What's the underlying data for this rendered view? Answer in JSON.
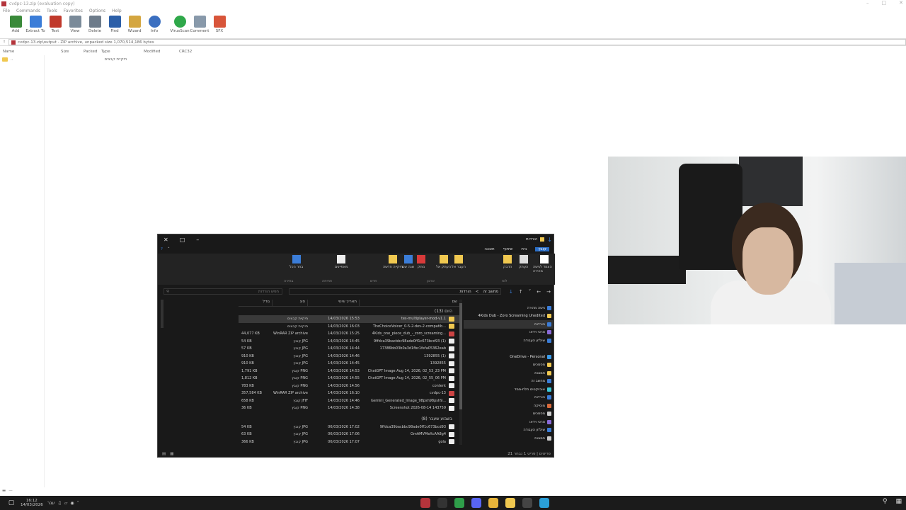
{
  "winrar": {
    "title": "cvdpc-13.zip (evaluation copy)",
    "menu": [
      "File",
      "Commands",
      "Tools",
      "Favorites",
      "Options",
      "Help"
    ],
    "toolbar": [
      {
        "label": "Add",
        "icon": "add-icon",
        "color": "#3a8a3a"
      },
      {
        "label": "Extract To",
        "icon": "extract-icon",
        "color": "#3b7dd8"
      },
      {
        "label": "Test",
        "icon": "test-icon",
        "color": "#c0392b"
      },
      {
        "label": "View",
        "icon": "view-icon",
        "color": "#7a8a99"
      },
      {
        "label": "Delete",
        "icon": "delete-icon",
        "color": "#6d7b8a"
      },
      {
        "label": "Find",
        "icon": "find-icon",
        "color": "#2c5fa8"
      },
      {
        "label": "Wizard",
        "icon": "wizard-icon",
        "color": "#d4a640"
      },
      {
        "label": "Info",
        "icon": "info-icon",
        "color": "#3b6fc0"
      },
      {
        "label": "VirusScan",
        "icon": "virusscan-icon",
        "color": "#2fa84a"
      },
      {
        "label": "Comment",
        "icon": "comment-icon",
        "color": "#8899aa"
      },
      {
        "label": "SFX",
        "icon": "sfx-icon",
        "color": "#d8553a"
      }
    ],
    "address": "cvdpc-13.zip\\output - ZIP archive, unpacked size 1,070,514,186 bytes",
    "columns": [
      "Name",
      "Size",
      "Packed",
      "Type",
      "Modified",
      "CRC32"
    ],
    "rows": [
      {
        "name": "..",
        "type": "תיקיית קבצים"
      }
    ],
    "status_left": "—"
  },
  "explorer": {
    "title": "הורדות",
    "tabs": [
      "קובץ",
      "בית",
      "שיתוף",
      "תצוגה"
    ],
    "active_tab": "קובץ",
    "ribbon_groups": [
      "לוח",
      "ארגון",
      "חדש",
      "פתיחה",
      "בחירה"
    ],
    "ribbon_buttons": [
      {
        "label": "הצמד לגישה מהירה",
        "icon": "pin-icon"
      },
      {
        "label": "העתק",
        "icon": "copy-icon"
      },
      {
        "label": "הדבק",
        "icon": "paste-icon"
      },
      {
        "label": "העבר אל",
        "icon": "move-icon"
      },
      {
        "label": "העתק אל",
        "icon": "copyto-icon"
      },
      {
        "label": "מחק",
        "icon": "delete-x-icon"
      },
      {
        "label": "שנה שם",
        "icon": "rename-icon"
      },
      {
        "label": "תיקייה חדשה",
        "icon": "newfolder-icon"
      },
      {
        "label": "מאפיינים",
        "icon": "properties-icon"
      },
      {
        "label": "בחר הכל",
        "icon": "selectall-icon"
      }
    ],
    "search_placeholder": "חפש הורדות",
    "path": [
      "מחשב זה",
      "הורדות"
    ],
    "columns": [
      "שם",
      "תאריך שינוי",
      "סוג",
      "גודל"
    ],
    "groups": [
      {
        "label": "היום (13)",
        "files": [
          {
            "name": "tes-multiplayer-mod-v1.1",
            "date": "14/03/2026 15:53",
            "type": "תיקיית קבצים",
            "size": "",
            "kind": "folder",
            "selected": true
          },
          {
            "name": "TheChoiceVoicer_0-5-2-dev-2-compatib...",
            "date": "14/03/2026 16:03",
            "type": "תיקיית קבצים",
            "size": "",
            "kind": "folder",
            "selected": false
          },
          {
            "name": "4Kids_one_piece_dub_-_zoro_screaming...",
            "date": "14/03/2026 15:25",
            "type": "WinRAR ZIP archive",
            "size": "44,077 KB",
            "kind": "zip",
            "selected": false
          },
          {
            "name": "9ffdca39bacbbc98ade0ff1c673bcd93 (1)",
            "date": "14/03/2026 14:45",
            "type": "קובץ JPG",
            "size": "54 KB",
            "kind": "file",
            "selected": false
          },
          {
            "name": "17386bb03b0a3d1fbc1fefa05362eab",
            "date": "14/03/2026 14:44",
            "type": "קובץ JPG",
            "size": "57 KB",
            "kind": "file",
            "selected": false
          },
          {
            "name": "1392855 (1)",
            "date": "14/03/2026 14:46",
            "type": "קובץ JPG",
            "size": "910 KB",
            "kind": "file",
            "selected": false
          },
          {
            "name": "1392855",
            "date": "14/03/2026 14:45",
            "type": "קובץ JPG",
            "size": "910 KB",
            "kind": "file",
            "selected": false
          },
          {
            "name": "ChatGPT Image Aug 14, 2026, 02_53_23 PM",
            "date": "14/03/2026 14:53",
            "type": "קובץ PNG",
            "size": "1,791 KB",
            "kind": "file",
            "selected": false
          },
          {
            "name": "ChatGPT Image Aug 14, 2026, 02_55_06 PM",
            "date": "14/03/2026 14:55",
            "type": "קובץ PNG",
            "size": "1,812 KB",
            "kind": "file",
            "selected": false
          },
          {
            "name": "content",
            "date": "14/03/2026 14:56",
            "type": "קובץ PNG",
            "size": "783 KB",
            "kind": "file",
            "selected": false
          },
          {
            "name": "cvdpc-13",
            "date": "14/03/2026 16:10",
            "type": "WinRAR ZIP archive",
            "size": "357,584 KB",
            "kind": "zip",
            "selected": false
          },
          {
            "name": "Gemini_Generated_Image_98psh98psh9...",
            "date": "14/03/2026 14:46",
            "type": "קובץ JFIF",
            "size": "658 KB",
            "kind": "file",
            "selected": false
          },
          {
            "name": "Screenshot 2026-08-14 143759",
            "date": "14/03/2026 14:38",
            "type": "קובץ PNG",
            "size": "36 KB",
            "kind": "file",
            "selected": false
          }
        ]
      },
      {
        "label": "בשבוע שעבר (8)",
        "files": [
          {
            "name": "9ffdca39bacbbc98ade0ff1c673bcd93",
            "date": "06/03/2026 17:02",
            "type": "קובץ JPG",
            "size": "54 KB",
            "kind": "file",
            "selected": false
          },
          {
            "name": "GmAMVMeXcAA8g4",
            "date": "06/03/2026 17:06",
            "type": "קובץ JPG",
            "size": "63 KB",
            "kind": "file",
            "selected": false
          },
          {
            "name": "gola",
            "date": "06/03/2026 17:07",
            "type": "קובץ JPG",
            "size": "366 KB",
            "kind": "file",
            "selected": false
          }
        ]
      }
    ],
    "sidebar": [
      {
        "label": "גישה מהירה",
        "color": "#3b7dd8",
        "selected": false
      },
      {
        "label": "4Kids Dub - Zoro Screaming Unedited",
        "color": "#f0c850",
        "selected": false
      },
      {
        "label": "הורדות",
        "color": "#3b7dd8",
        "selected": true
      },
      {
        "label": "סרטי וידאו",
        "color": "#8a6ad8",
        "selected": false
      },
      {
        "label": "שולחן העבודה",
        "color": "#3b7dd8",
        "selected": false
      },
      {
        "label": "",
        "color": "",
        "selected": false
      },
      {
        "label": "OneDrive - Personal",
        "color": "#3b9be8",
        "selected": false
      },
      {
        "label": "מסמכים",
        "color": "#f0c850",
        "selected": false
      },
      {
        "label": "תמונות",
        "color": "#f0c850",
        "selected": false
      },
      {
        "label": "מחשב זה",
        "color": "#3b7dd8",
        "selected": false
      },
      {
        "label": "אובייקטים תלת-ממד",
        "color": "#3bc8d8",
        "selected": false
      },
      {
        "label": "הורדות",
        "color": "#3b7dd8",
        "selected": false
      },
      {
        "label": "מוסיקה",
        "color": "#d86a3b",
        "selected": false
      },
      {
        "label": "מסמכים",
        "color": "#cccccc",
        "selected": false
      },
      {
        "label": "סרטי וידאו",
        "color": "#8a6ad8",
        "selected": false
      },
      {
        "label": "שולחן העבודה",
        "color": "#3b7dd8",
        "selected": false
      },
      {
        "label": "תמונות",
        "color": "#cccccc",
        "selected": false
      }
    ],
    "status": "21 פריטים  |  פריט 1 נבחר"
  },
  "taskbar": {
    "time": "16:12",
    "date": "14/03/2026",
    "lang": "עבר",
    "apps": [
      {
        "name": "winrar-taskbar-icon",
        "color": "#b4343b"
      },
      {
        "name": "obs-taskbar-icon",
        "color": "#333333"
      },
      {
        "name": "chrome-taskbar-icon",
        "color": "#2f9e4a"
      },
      {
        "name": "discord-taskbar-icon",
        "color": "#5865f2"
      },
      {
        "name": "chrome-alt-taskbar-icon",
        "color": "#e8b53a"
      },
      {
        "name": "explorer-taskbar-icon",
        "color": "#f0c850"
      },
      {
        "name": "app-taskbar-icon",
        "color": "#444444"
      },
      {
        "name": "edge-taskbar-icon",
        "color": "#2a9fd8"
      }
    ]
  }
}
